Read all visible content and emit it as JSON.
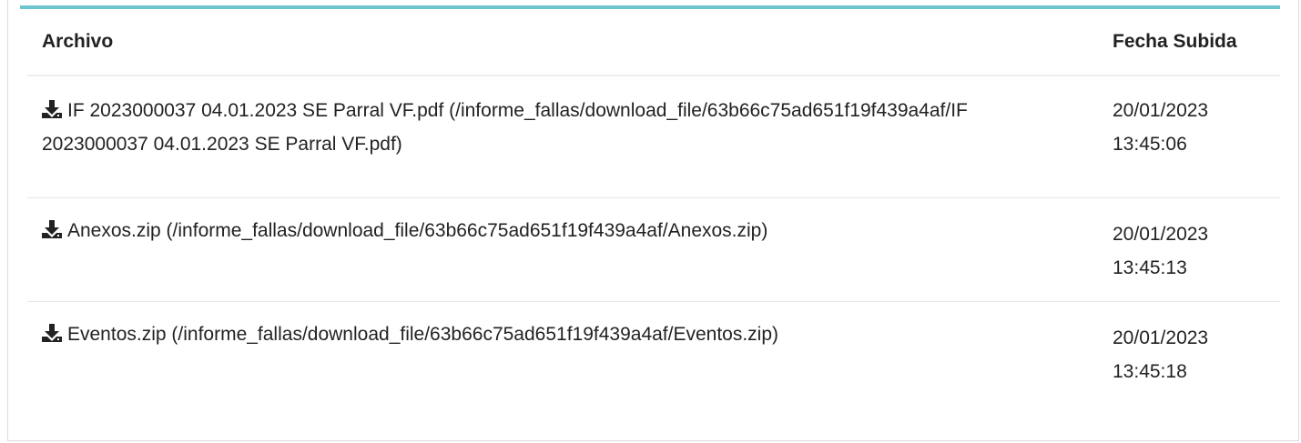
{
  "colors": {
    "accent": "#6cc5cf",
    "text": "#222222",
    "row_divider": "#e6e6e6"
  },
  "table": {
    "headers": {
      "file": "Archivo",
      "date": "Fecha Subida"
    },
    "rows": [
      {
        "icon": "download-icon",
        "link_text": "IF 2023000037 04.01.2023 SE Parral VF.pdf (/informe_fallas/download_file/63b66c75ad651f19f439a4af/IF 2023000037 04.01.2023 SE Parral VF.pdf)",
        "date": "20/01/2023",
        "time": "13:45:06"
      },
      {
        "icon": "download-icon",
        "link_text": "Anexos.zip (/informe_fallas/download_file/63b66c75ad651f19f439a4af/Anexos.zip)",
        "date": "20/01/2023",
        "time": "13:45:13"
      },
      {
        "icon": "download-icon",
        "link_text": "Eventos.zip (/informe_fallas/download_file/63b66c75ad651f19f439a4af/Eventos.zip)",
        "date": "20/01/2023",
        "time": "13:45:18"
      }
    ]
  }
}
